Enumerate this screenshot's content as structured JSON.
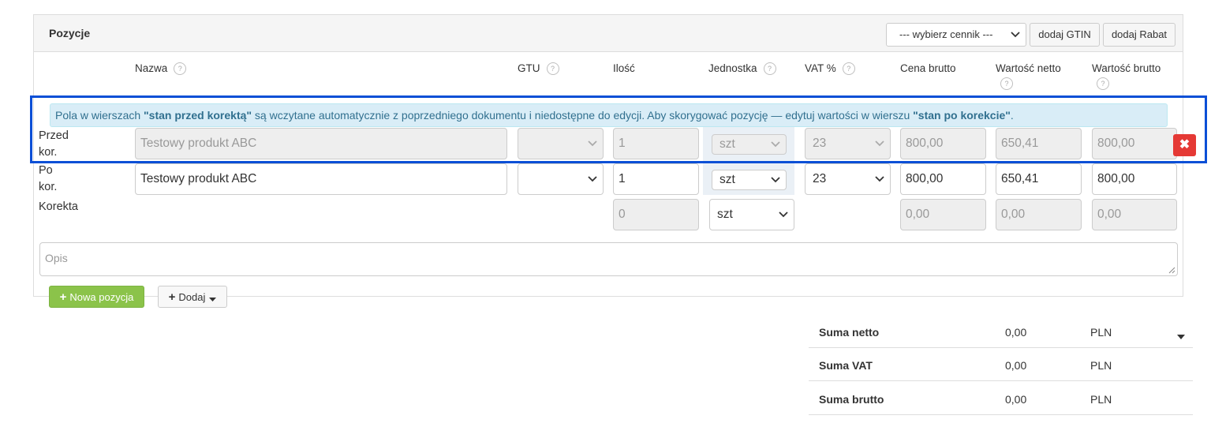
{
  "panel": {
    "title": "Pozycje",
    "price_list_select": "--- wybierz cennik ---",
    "add_gtin_label": "dodaj GTIN",
    "add_discount_label": "dodaj Rabat"
  },
  "columns": {
    "name": "Nazwa",
    "gtu": "GTU",
    "qty": "Ilość",
    "unit": "Jednostka",
    "vat": "VAT %",
    "gross_price": "Cena brutto",
    "net_value": "Wartość netto",
    "gross_value": "Wartość brutto",
    "help_glyph": "?"
  },
  "info": {
    "pre": "Pola w wierszach ",
    "b1": "\"stan przed korektą\"",
    "mid": " są wczytane automatycznie z poprzedniego dokumentu i niedostępne do edycji. Aby skorygować pozycję — edytuj wartości w wierszu ",
    "b2": "\"stan po korekcie\"",
    "post": "."
  },
  "rows": {
    "before": {
      "label_line1": "Przed",
      "label_line2": "kor.",
      "name": "Testowy produkt ABC",
      "gtu": "",
      "qty": "1",
      "unit": "szt",
      "vat": "23",
      "gross_price": "800,00",
      "net_value": "650,41",
      "gross_value": "800,00"
    },
    "after": {
      "label_line1": "Po",
      "label_line2": "kor.",
      "name": "Testowy produkt ABC",
      "gtu": "",
      "qty": "1",
      "unit": "szt",
      "vat": "23",
      "gross_price": "800,00",
      "net_value": "650,41",
      "gross_value": "800,00"
    },
    "correction": {
      "label": "Korekta",
      "qty": "0",
      "unit": "szt",
      "gross_price": "0,00",
      "net_value": "0,00",
      "gross_value": "0,00"
    }
  },
  "description_placeholder": "Opis",
  "buttons": {
    "new_position": "Nowa pozycja",
    "add": "Dodaj",
    "delete_glyph": "✖"
  },
  "summary": [
    {
      "label": "Suma netto",
      "value": "0,00",
      "currency": "PLN"
    },
    {
      "label": "Suma VAT",
      "value": "0,00",
      "currency": "PLN"
    },
    {
      "label": "Suma brutto",
      "value": "0,00",
      "currency": "PLN"
    }
  ],
  "colors": {
    "highlight_border": "#0a4fd6",
    "info_bg": "#d9edf7",
    "info_text": "#31708f",
    "new_button": "#8bc34a",
    "delete_button": "#e53935"
  }
}
